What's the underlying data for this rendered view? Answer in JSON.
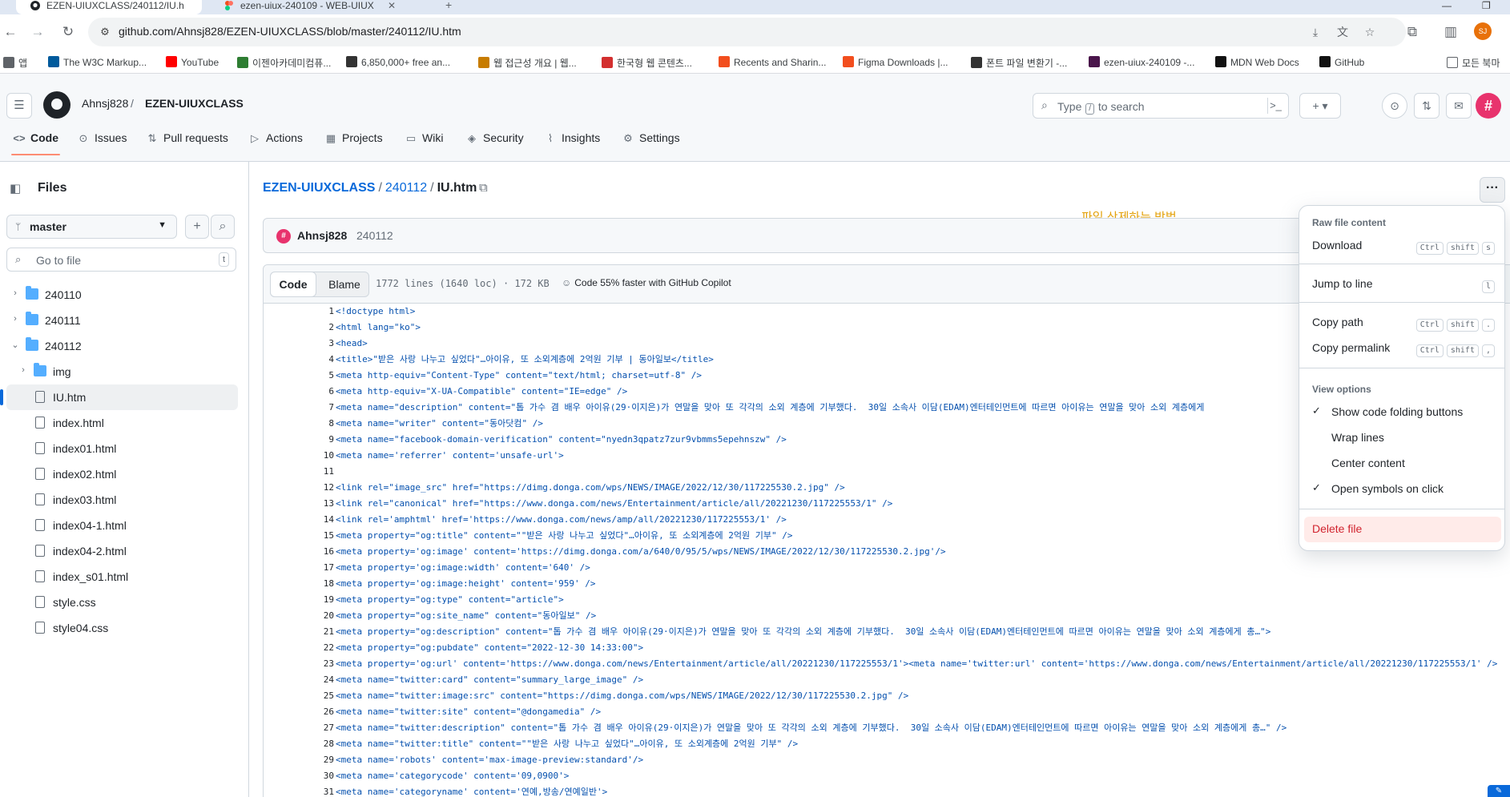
{
  "browser": {
    "tabs": [
      {
        "title": "EZEN-UIUXCLASS/240112/IU.h",
        "active": true
      },
      {
        "title": "ezen-uiux-240109 - WEB-UIUX",
        "active": false
      }
    ],
    "new_tab": "+",
    "url": "github.com/Ahnsj828/EZEN-UIUXCLASS/blob/master/240112/IU.htm",
    "profile_initials": "SJ",
    "bookmarks": [
      {
        "label": "앱",
        "icon": "apps-grid-icon",
        "color": "#5f6368"
      },
      {
        "label": "The W3C Markup...",
        "icon": "w3c-icon",
        "color": "#005a9c"
      },
      {
        "label": "YouTube",
        "icon": "youtube-icon",
        "color": "#ff0000"
      },
      {
        "label": "이젠아카데미컴퓨...",
        "icon": "ezen-icon",
        "color": "#2e7d32"
      },
      {
        "label": "6,850,000+ free an...",
        "icon": "lottie-icon",
        "color": "#333333"
      },
      {
        "label": "웹 접근성 개요 | 웹...",
        "icon": "wa-icon",
        "color": "#c77c00"
      },
      {
        "label": "한국형 웹 콘텐츠...",
        "icon": "pdf-icon",
        "color": "#d32f2f"
      },
      {
        "label": "Recents and Sharin...",
        "icon": "figma-icon",
        "color": "#f24e1e"
      },
      {
        "label": "Figma Downloads |...",
        "icon": "figma-icon",
        "color": "#f24e1e"
      },
      {
        "label": "폰트 파일 변환기 -...",
        "icon": "wrench-icon",
        "color": "#333333"
      },
      {
        "label": "ezen-uiux-240109 -...",
        "icon": "slack-icon",
        "color": "#4a154b"
      },
      {
        "label": "MDN Web Docs",
        "icon": "mdn-icon",
        "color": "#111111"
      },
      {
        "label": "GitHub",
        "icon": "github-icon",
        "color": "#111111"
      }
    ],
    "all_bookmarks": "모든 북마"
  },
  "github": {
    "owner": "Ahnsj828",
    "repo": "EZEN-UIUXCLASS",
    "search_placeholder_pre": "Type",
    "search_key": "/",
    "search_placeholder_post": "to search",
    "nav": [
      {
        "label": "Code",
        "icon": "code-icon",
        "selected": true
      },
      {
        "label": "Issues",
        "icon": "issue-icon",
        "selected": false
      },
      {
        "label": "Pull requests",
        "icon": "pull-request-icon",
        "selected": false
      },
      {
        "label": "Actions",
        "icon": "actions-icon",
        "selected": false
      },
      {
        "label": "Projects",
        "icon": "projects-icon",
        "selected": false
      },
      {
        "label": "Wiki",
        "icon": "wiki-icon",
        "selected": false
      },
      {
        "label": "Security",
        "icon": "shield-icon",
        "selected": false
      },
      {
        "label": "Insights",
        "icon": "graph-icon",
        "selected": false
      },
      {
        "label": "Settings",
        "icon": "gear-icon",
        "selected": false
      }
    ]
  },
  "sidebar": {
    "title": "Files",
    "branch": "master",
    "goto_placeholder": "Go to file",
    "goto_key": "t",
    "tree": [
      {
        "name": "240110",
        "type": "folder",
        "expanded": false,
        "depth": 0,
        "active": false
      },
      {
        "name": "240111",
        "type": "folder",
        "expanded": false,
        "depth": 0,
        "active": false
      },
      {
        "name": "240112",
        "type": "folder",
        "expanded": true,
        "depth": 0,
        "active": false
      },
      {
        "name": "img",
        "type": "folder",
        "expanded": false,
        "depth": 1,
        "active": false
      },
      {
        "name": "IU.htm",
        "type": "file",
        "depth": 1,
        "active": true
      },
      {
        "name": "index.html",
        "type": "file",
        "depth": 1,
        "active": false
      },
      {
        "name": "index01.html",
        "type": "file",
        "depth": 1,
        "active": false
      },
      {
        "name": "index02.html",
        "type": "file",
        "depth": 1,
        "active": false
      },
      {
        "name": "index03.html",
        "type": "file",
        "depth": 1,
        "active": false
      },
      {
        "name": "index04-1.html",
        "type": "file",
        "depth": 1,
        "active": false
      },
      {
        "name": "index04-2.html",
        "type": "file",
        "depth": 1,
        "active": false
      },
      {
        "name": "index_s01.html",
        "type": "file",
        "depth": 1,
        "active": false
      },
      {
        "name": "style.css",
        "type": "file",
        "depth": 1,
        "active": false
      },
      {
        "name": "style04.css",
        "type": "file",
        "depth": 1,
        "active": false
      }
    ]
  },
  "file": {
    "path": [
      "EZEN-UIUXCLASS",
      "240112",
      "IU.htm"
    ],
    "path_sep": "/",
    "note": "파일 삭제하는 방법",
    "commit_user": "Ahnsj828",
    "commit_msg": "240112",
    "view_code": "Code",
    "view_blame": "Blame",
    "info": "1772 lines (1640 loc) · 172 KB",
    "copilot": "Code 55% faster with GitHub Copilot",
    "lines": [
      "<!doctype html>",
      "<html lang=\"ko\">",
      "<head>",
      "<title>\"받은 사랑 나누고 싶었다\"…아이유, 또 소외계층에 2억원 기부 | 동아일보</title>",
      "<meta http-equiv=\"Content-Type\" content=\"text/html; charset=utf-8\" />",
      "<meta http-equiv=\"X-UA-Compatible\" content=\"IE=edge\" />",
      "<meta name=\"description\" content=\"톱 가수 겸 배우 아이유(29·이지은)가 연말을 맞아 또 각각의 소외 계층에 기부했다.  30일 소속사 이담(EDAM)엔터테인먼트에 따르면 아이유는 연말을 맞아 소외 계층에게",
      "<meta name=\"writer\" content=\"동아닷컴\" />",
      "<meta name=\"facebook-domain-verification\" content=\"nyedn3qpatz7zur9vbmms5epehnszw\" />",
      "<meta name='referrer' content='unsafe-url'>",
      "",
      "<link rel=\"image_src\" href=\"https://dimg.donga.com/wps/NEWS/IMAGE/2022/12/30/117225530.2.jpg\" />",
      "<link rel=\"canonical\" href=\"https://www.donga.com/news/Entertainment/article/all/20221230/117225553/1\" />",
      "<link rel='amphtml' href='https://www.donga.com/news/amp/all/20221230/117225553/1' />",
      "<meta property=\"og:title\" content=\"\"받은 사랑 나누고 싶었다\"…아이유, 또 소외계층에 2억원 기부\" />",
      "<meta property='og:image' content='https://dimg.donga.com/a/640/0/95/5/wps/NEWS/IMAGE/2022/12/30/117225530.2.jpg'/>",
      "<meta property='og:image:width' content='640' />",
      "<meta property='og:image:height' content='959' />",
      "<meta property=\"og:type\" content=\"article\">",
      "<meta property=\"og:site_name\" content=\"동아일보\" />",
      "<meta property=\"og:description\" content=\"톱 가수 겸 배우 아이유(29·이지은)가 연말을 맞아 또 각각의 소외 계층에 기부했다.  30일 소속사 이담(EDAM)엔터테인먼트에 따르면 아이유는 연말을 맞아 소외 계층에게 총…\">",
      "<meta property=\"og:pubdate\" content=\"2022-12-30 14:33:00\">",
      "<meta property='og:url' content='https://www.donga.com/news/Entertainment/article/all/20221230/117225553/1'><meta name='twitter:url' content='https://www.donga.com/news/Entertainment/article/all/20221230/117225553/1' />",
      "<meta name=\"twitter:card\" content=\"summary_large_image\" />",
      "<meta name=\"twitter:image:src\" content=\"https://dimg.donga.com/wps/NEWS/IMAGE/2022/12/30/117225530.2.jpg\" />",
      "<meta name=\"twitter:site\" content=\"@dongamedia\" />",
      "<meta name=\"twitter:description\" content=\"톱 가수 겸 배우 아이유(29·이지은)가 연말을 맞아 또 각각의 소외 계층에 기부했다.  30일 소속사 이담(EDAM)엔터테인먼트에 따르면 아이유는 연말을 맞아 소외 계층에게 총…\" />",
      "<meta name=\"twitter:title\" content=\"\"받은 사랑 나누고 싶었다\"…아이유, 또 소외계층에 2억원 기부\" />",
      "<meta name='robots' content='max-image-preview:standard'/>",
      "<meta name='categorycode' content='09,0900'>",
      "<meta name='categoryname' content='연예,방송/연예일반'>"
    ]
  },
  "menu": {
    "section_raw": "Raw file content",
    "download": "Download",
    "download_keys": [
      "Ctrl",
      "shift",
      "s"
    ],
    "jump": "Jump to line",
    "jump_keys": [
      "l"
    ],
    "copy_path": "Copy path",
    "copy_path_keys": [
      "Ctrl",
      "shift",
      "."
    ],
    "copy_permalink": "Copy permalink",
    "copy_permalink_keys": [
      "Ctrl",
      "shift",
      ","
    ],
    "section_view": "View options",
    "options": [
      {
        "label": "Show code folding buttons",
        "checked": true
      },
      {
        "label": "Wrap lines",
        "checked": false
      },
      {
        "label": "Center content",
        "checked": false
      },
      {
        "label": "Open symbols on click",
        "checked": true
      }
    ],
    "delete": "Delete file"
  },
  "colors": {
    "accent": "#0969da",
    "danger": "#d1242f",
    "note": "#e3a008",
    "tab_underline": "#fd8c73"
  }
}
